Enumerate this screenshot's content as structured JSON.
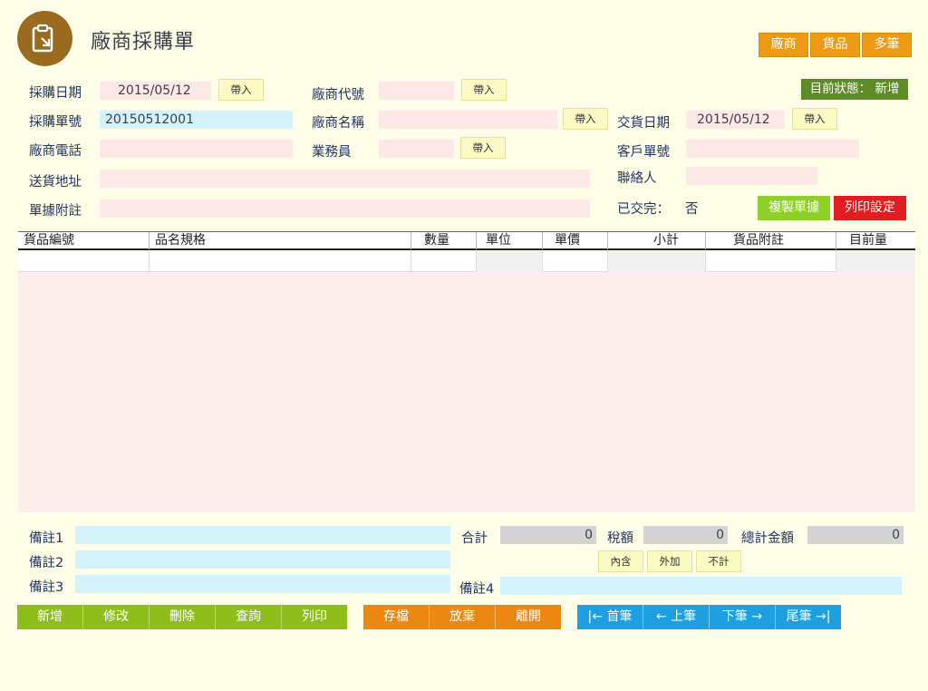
{
  "header": {
    "title": "廠商採購單"
  },
  "top_buttons": [
    "廠商",
    "貨品",
    "多筆"
  ],
  "status": "目前狀態： 新增",
  "form": {
    "purchase_date_label": "採購日期",
    "purchase_date": "2015/05/12",
    "order_no_label": "採購單號",
    "order_no": "20150512001",
    "vendor_phone_label": "廠商電話",
    "vendor_phone": "",
    "address_label": "送貨地址",
    "address": "",
    "note_label": "單據附註",
    "note": "",
    "vendor_code_label": "廠商代號",
    "vendor_code": "",
    "vendor_name_label": "廠商名稱",
    "vendor_name": "",
    "sales_label": "業務員",
    "sales": "",
    "delivery_date_label": "交貨日期",
    "delivery_date": "2015/05/12",
    "customer_no_label": "客戶單號",
    "customer_no": "",
    "contact_label": "聯絡人",
    "contact": "",
    "delivered_label": "已交完：",
    "delivered": "否",
    "import_label": "帶入"
  },
  "action_buttons": {
    "copy": "複製單據",
    "print_setting": "列印設定"
  },
  "table": {
    "columns": [
      "貨品編號",
      "品名規格",
      "數量",
      "單位",
      "單價",
      "小計",
      "貨品附註",
      "目前量"
    ]
  },
  "footer": {
    "remark1_label": "備註1",
    "remark2_label": "備註2",
    "remark3_label": "備註3",
    "remark4_label": "備註4",
    "total_label": "合計",
    "total": "0",
    "tax_label": "稅額",
    "tax": "0",
    "grand_total_label": "總計金額",
    "grand_total": "0",
    "tax_options": [
      "內含",
      "外加",
      "不計"
    ]
  },
  "toolbar": {
    "green": [
      "新增",
      "修改",
      "刪除",
      "查詢",
      "列印"
    ],
    "orange": [
      "存檔",
      "放棄",
      "離開"
    ],
    "blue": [
      "|← 首筆",
      "← 上筆",
      "下筆 →",
      "尾筆 →|"
    ]
  },
  "colors": {
    "background": "#fefde8",
    "field_pink": "#fde8e8",
    "field_blue": "#d4f2fb",
    "accent_orange": "#ec9b12",
    "accent_green": "#8fbe1a",
    "accent_blue": "#1e9fe0"
  }
}
